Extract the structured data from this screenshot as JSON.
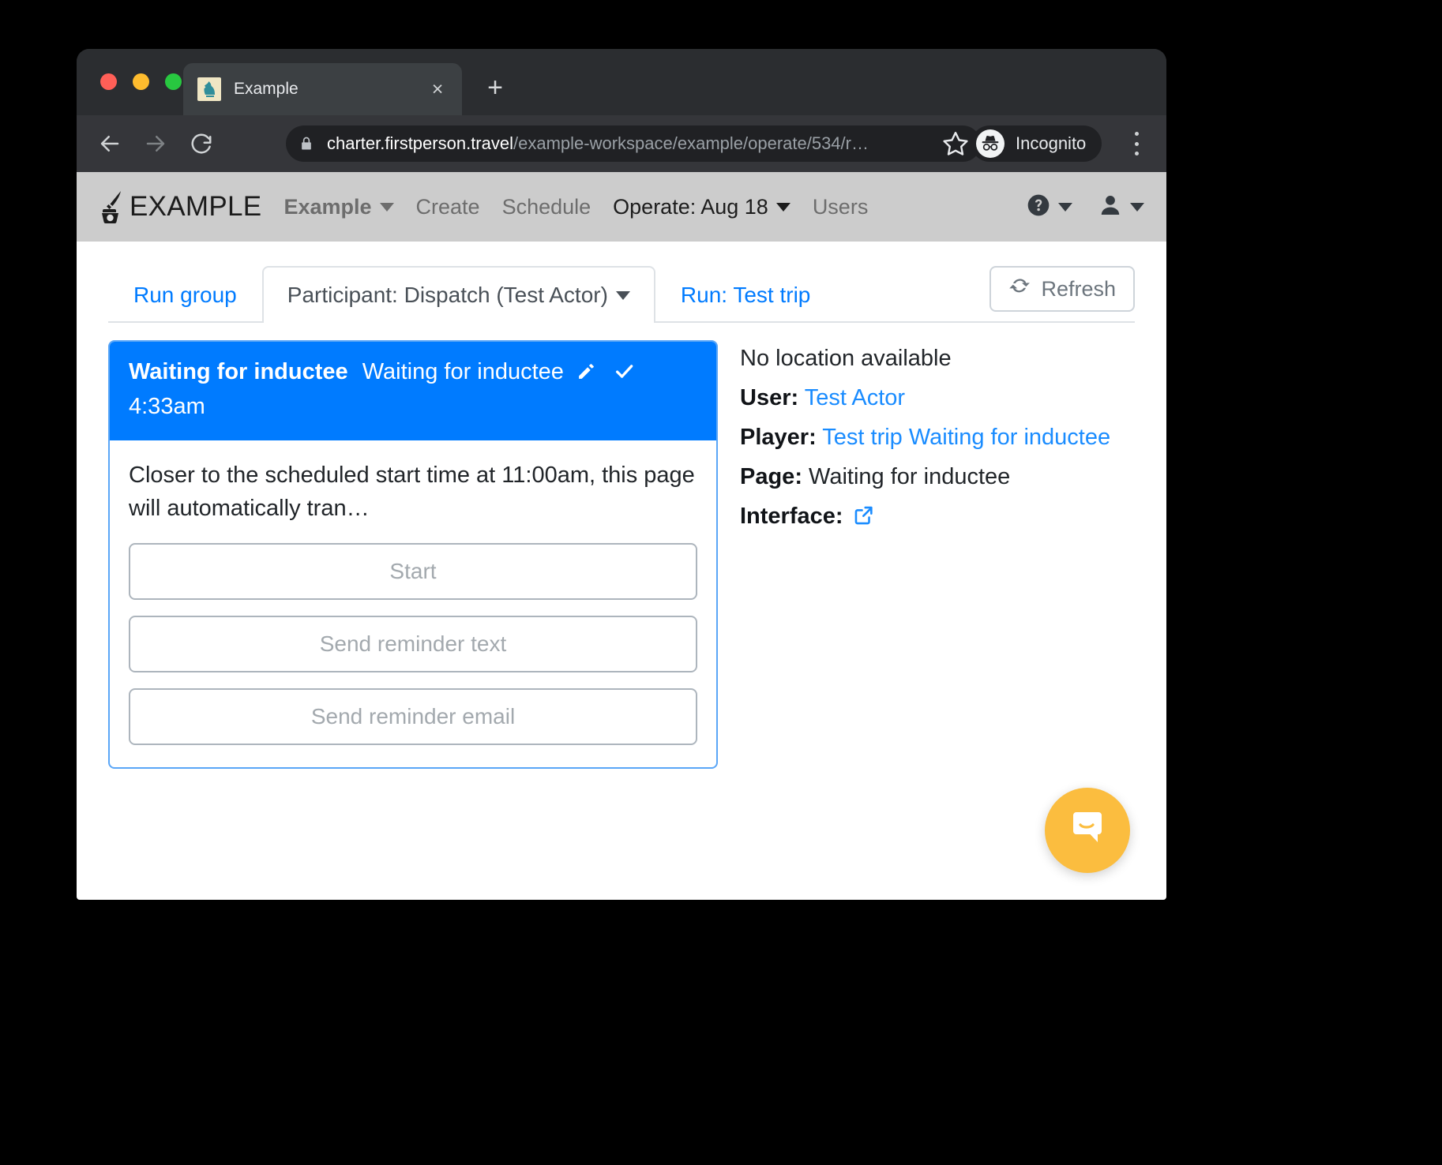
{
  "browser": {
    "tab": {
      "title": "Example",
      "favicon": "chess-knight-icon",
      "close_label": "×"
    },
    "new_tab_label": "+",
    "url": {
      "host": "charter.firstperson.travel",
      "path": "/example-workspace/example/operate/534/r…"
    },
    "profile_pill": "Incognito",
    "icons": {
      "back": "back-arrow-icon",
      "forward": "forward-arrow-icon",
      "reload": "reload-icon",
      "lock": "lock-icon",
      "star": "star-icon",
      "menu": "kebab-menu-icon"
    }
  },
  "appnav": {
    "brand": "EXAMPLE",
    "items": [
      {
        "label": "Example",
        "caret": true,
        "style": "bold"
      },
      {
        "label": "Create",
        "caret": false,
        "style": "muted"
      },
      {
        "label": "Schedule",
        "caret": false,
        "style": "muted"
      },
      {
        "label": "Operate: Aug 18",
        "caret": true,
        "style": "dark"
      },
      {
        "label": "Users",
        "caret": false,
        "style": "muted"
      }
    ],
    "right": {
      "help": "help-circle-icon",
      "account": "user-icon"
    }
  },
  "tabs": [
    {
      "label": "Run group",
      "active": false,
      "caret": false
    },
    {
      "label": "Participant: Dispatch (Test Actor)",
      "active": true,
      "caret": true
    },
    {
      "label": "Run: Test trip",
      "active": false,
      "caret": false
    }
  ],
  "refresh": {
    "label": "Refresh",
    "icon": "refresh-icon"
  },
  "card": {
    "header": {
      "strong": "Waiting for inductee",
      "normal": "Waiting for inductee",
      "edit_icon": "pencil-icon",
      "check_icon": "check-icon",
      "time": "4:33am"
    },
    "body_text": "Closer to the scheduled start time at 11:00am, this page will automatically tran…",
    "actions": [
      {
        "label": "Start",
        "disabled": true
      },
      {
        "label": "Send reminder text",
        "disabled": true
      },
      {
        "label": "Send reminder email",
        "disabled": true
      }
    ]
  },
  "details": {
    "location": "No location available",
    "rows": [
      {
        "label": "User:",
        "value": "Test Actor",
        "link": true
      },
      {
        "label": "Player:",
        "value": "Test trip Waiting for inductee",
        "link": true
      },
      {
        "label": "Page:",
        "value": "Waiting for inductee",
        "link": false
      }
    ],
    "interface_label": "Interface:",
    "interface_icon": "external-link-icon"
  },
  "chat": {
    "icon": "chat-bubble-icon"
  },
  "colors": {
    "accent_blue": "#007bff",
    "link_blue": "#1a8cff",
    "chat_yellow": "#fbbd3f",
    "navbar_grey": "#cccccc"
  }
}
